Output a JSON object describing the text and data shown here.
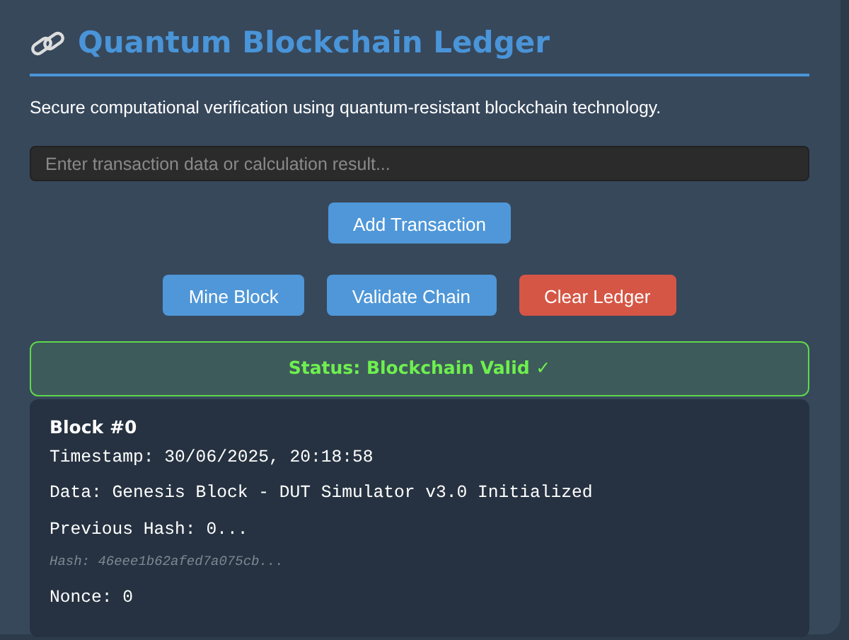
{
  "title": "Quantum Blockchain Ledger",
  "description": "Secure computational verification using quantum-resistant blockchain technology.",
  "input": {
    "placeholder": "Enter transaction data or calculation result..."
  },
  "add_button": {
    "label": "Add Transaction",
    "kind": "primary"
  },
  "action_buttons": [
    {
      "label": "Mine Block",
      "kind": "primary"
    },
    {
      "label": "Validate Chain",
      "kind": "primary"
    },
    {
      "label": "Clear Ledger",
      "kind": "danger"
    }
  ],
  "status": {
    "text": "Status: Blockchain Valid ✓",
    "kind": "valid"
  },
  "blocks": [
    {
      "title": "Block #0",
      "lines": [
        {
          "text": "Timestamp: 30/06/2025, 20:18:58",
          "kind": "plain"
        },
        {
          "text": "Data: Genesis Block - DUT Simulator v3.0 Initialized",
          "kind": "plain"
        },
        {
          "text": "Previous Hash: 0...",
          "kind": "plain"
        },
        {
          "text": "Hash: 46eee1b62afed7a075cb...",
          "kind": "hash"
        },
        {
          "text": "Nonce: 0",
          "kind": "plain"
        }
      ]
    }
  ]
}
